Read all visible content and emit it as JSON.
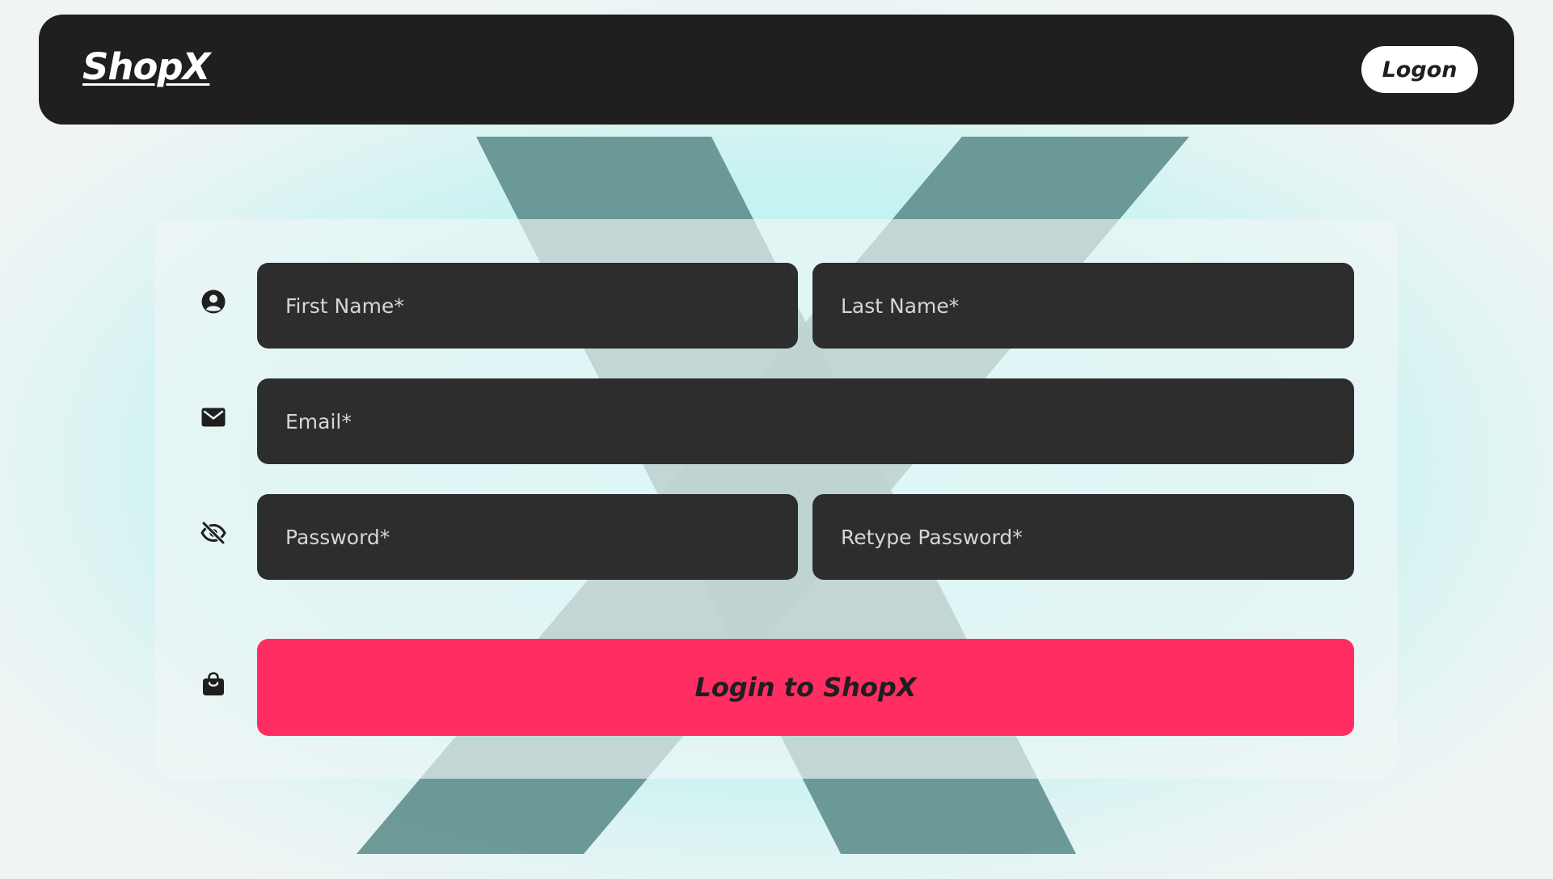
{
  "navbar": {
    "brand": "ShopX",
    "logon_label": "Logon"
  },
  "form": {
    "first_name": {
      "placeholder": "First Name*",
      "value": ""
    },
    "last_name": {
      "placeholder": "Last Name*",
      "value": ""
    },
    "email": {
      "placeholder": "Email*",
      "value": ""
    },
    "password": {
      "placeholder": "Password*",
      "value": ""
    },
    "retype_password": {
      "placeholder": "Retype Password*",
      "value": ""
    },
    "submit_label": "Login to ShopX"
  },
  "icons": {
    "name_row": "user-circle-icon",
    "email_row": "envelope-icon",
    "password_row": "eye-slash-icon",
    "submit_row": "shopping-bag-icon"
  },
  "colors": {
    "navbar_bg": "#1f1f1f",
    "field_bg": "#2d2d2d",
    "accent": "#ff2d61",
    "background_x": "#5f8f8d",
    "background_glow": "#b9f6f3"
  }
}
